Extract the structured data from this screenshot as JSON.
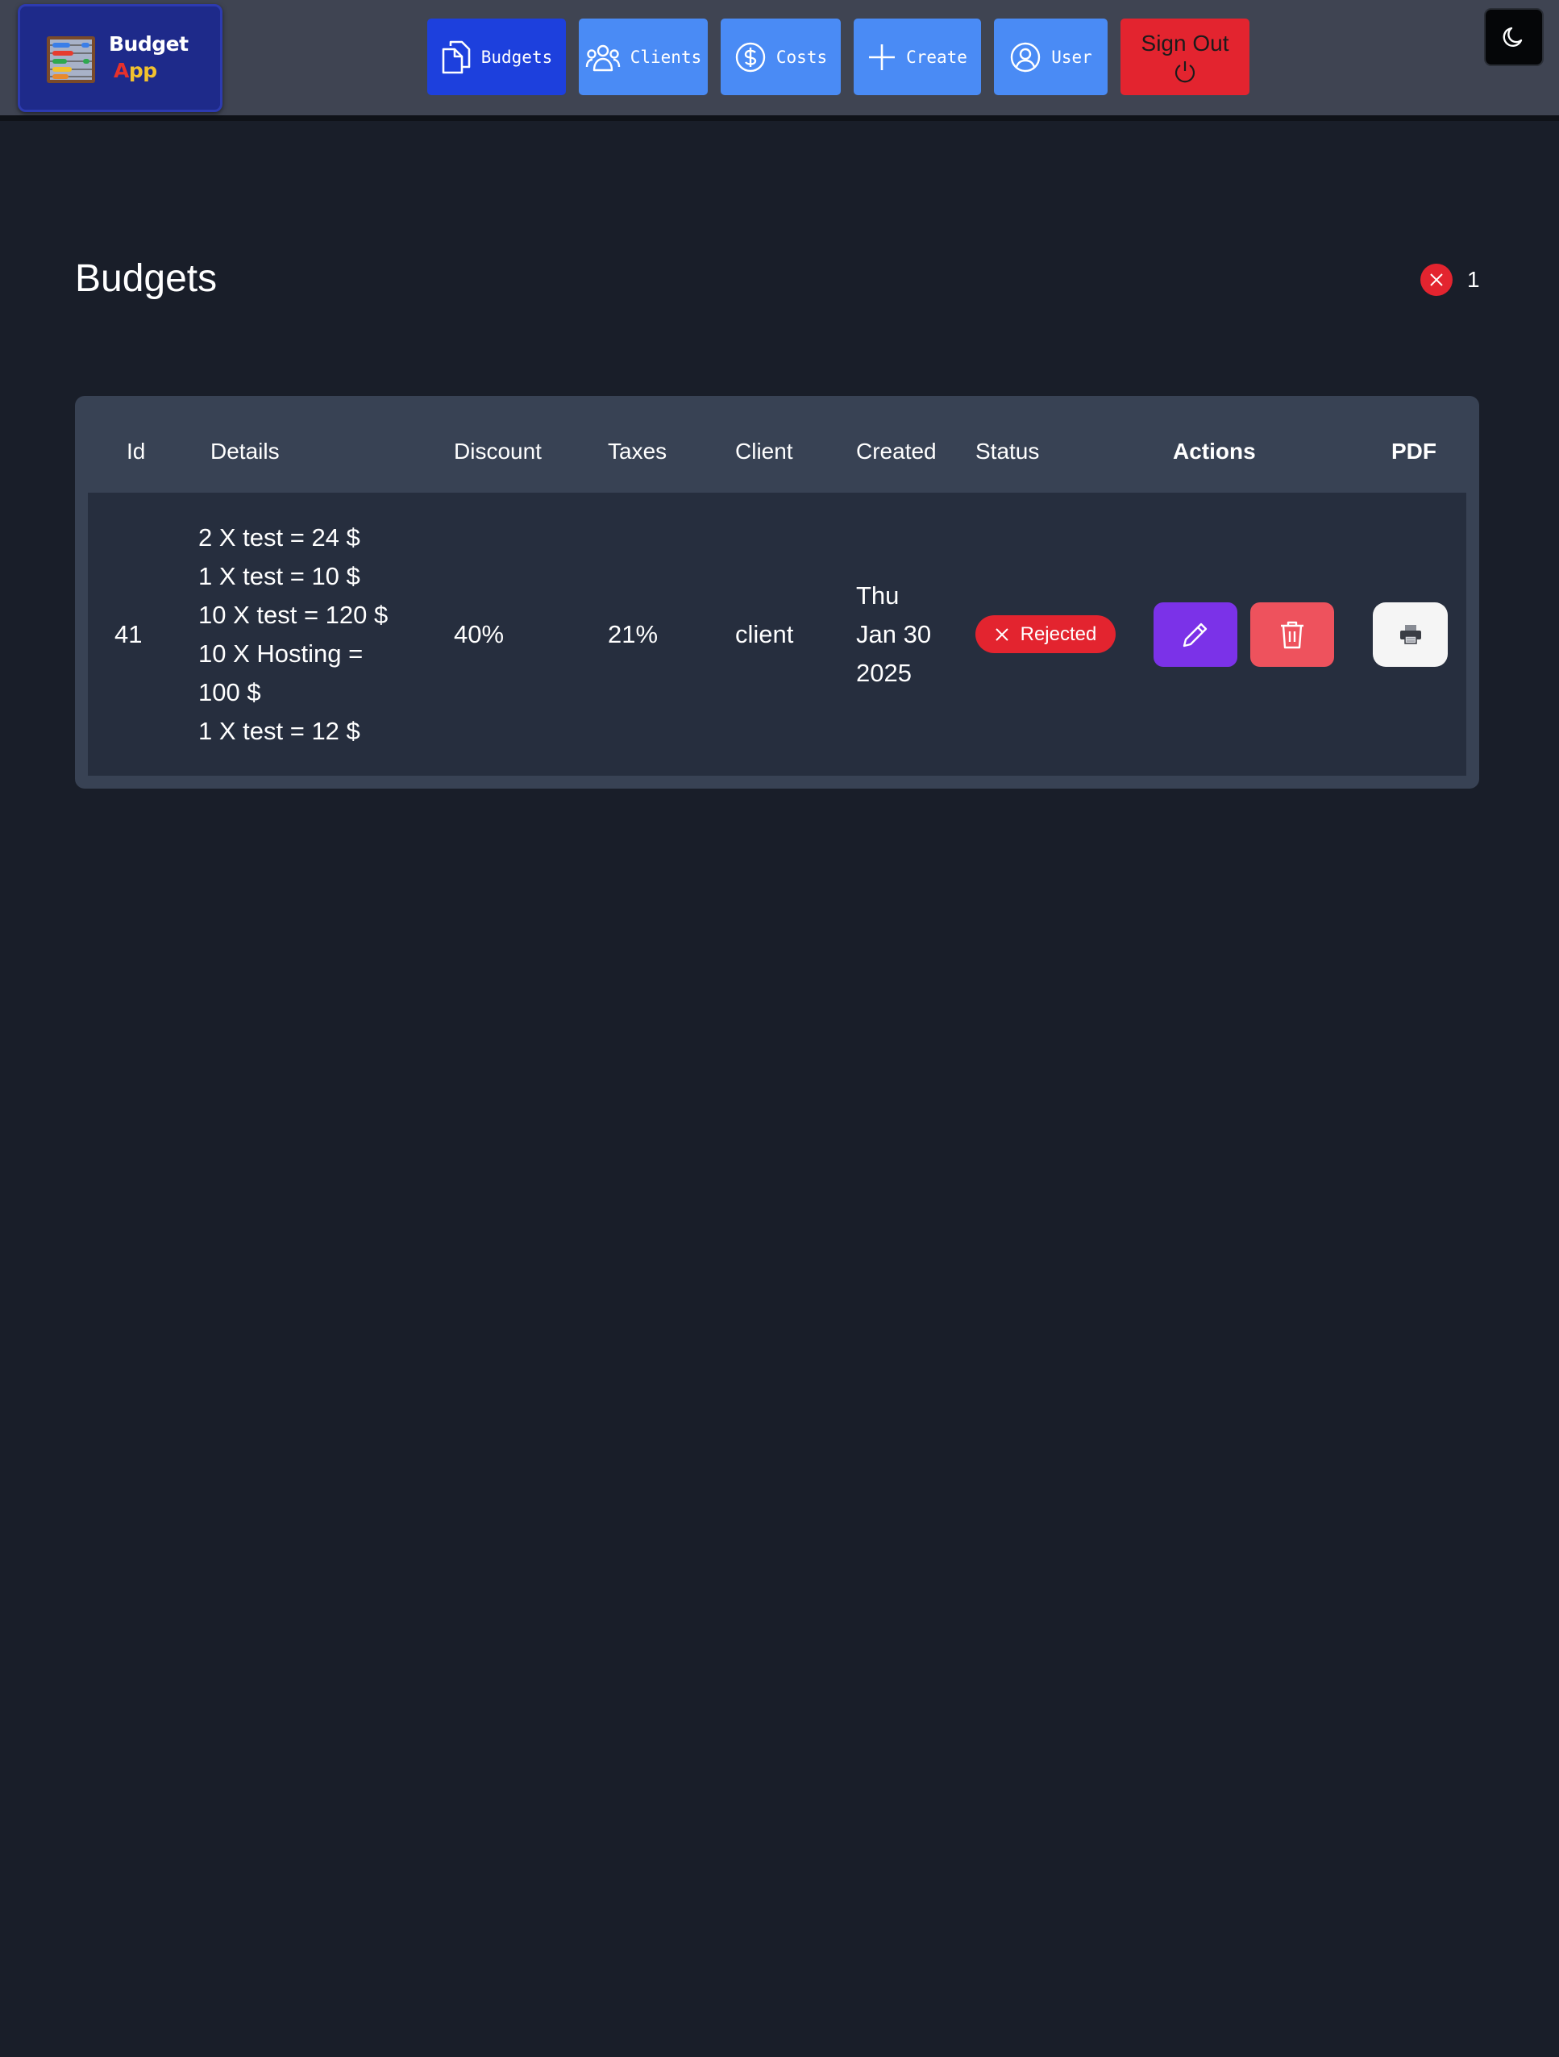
{
  "brand": {
    "word1": "Budget",
    "word2_a": "A",
    "word2_b": "pp",
    "logo_icon": "abacus-icon"
  },
  "nav": {
    "budgets": {
      "label": "Budgets",
      "icon": "documents-icon"
    },
    "clients": {
      "label": "Clients",
      "icon": "users-icon"
    },
    "costs": {
      "label": "Costs",
      "icon": "dollar-circle-icon"
    },
    "create": {
      "label": "Create",
      "icon": "plus-icon"
    },
    "user": {
      "label": "User",
      "icon": "user-circle-icon"
    },
    "signout": {
      "label": "Sign Out",
      "icon": "power-icon"
    },
    "theme_toggle_icon": "moon-icon"
  },
  "page": {
    "title": "Budgets",
    "rejected_count": "1"
  },
  "table": {
    "headers": {
      "id": "Id",
      "details": "Details",
      "discount": "Discount",
      "taxes": "Taxes",
      "client": "Client",
      "created": "Created",
      "status": "Status",
      "actions": "Actions",
      "pdf": "PDF"
    },
    "rows": [
      {
        "id": "41",
        "details": [
          "2 X test = 24 $",
          "1 X test = 10 $",
          "10 X test = 120 $",
          "10 X Hosting =",
          "100 $",
          "1 X test = 12 $"
        ],
        "discount": "40%",
        "taxes": "21%",
        "client": "client",
        "created": [
          "Thu",
          "Jan 30",
          "2025"
        ],
        "status": "Rejected"
      }
    ]
  },
  "colors": {
    "background": "#191e29",
    "navbar": "#3f4452",
    "active_nav": "#1d40dd",
    "nav": "#4a8bf5",
    "danger": "#e3242f",
    "edit": "#7b32e8",
    "delete": "#ee525d"
  }
}
